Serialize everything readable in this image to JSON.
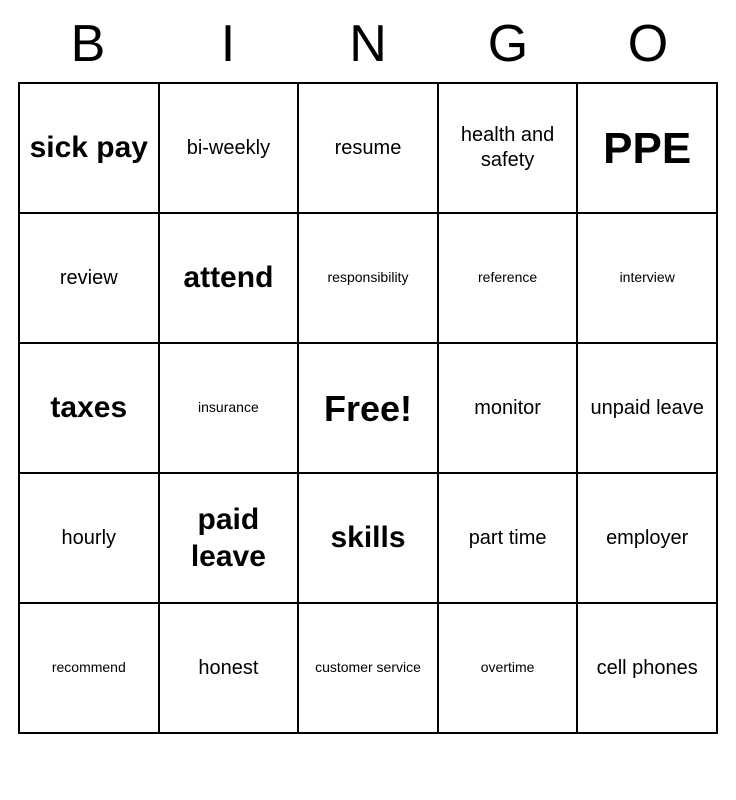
{
  "header": {
    "letters": [
      "B",
      "I",
      "N",
      "G",
      "O"
    ]
  },
  "cells": [
    {
      "text": "sick pay",
      "size": "large"
    },
    {
      "text": "bi-weekly",
      "size": "medium"
    },
    {
      "text": "resume",
      "size": "medium"
    },
    {
      "text": "health and safety",
      "size": "medium"
    },
    {
      "text": "PPE",
      "size": "xlarge"
    },
    {
      "text": "review",
      "size": "medium"
    },
    {
      "text": "attend",
      "size": "large"
    },
    {
      "text": "responsibility",
      "size": "small"
    },
    {
      "text": "reference",
      "size": "small"
    },
    {
      "text": "interview",
      "size": "small"
    },
    {
      "text": "taxes",
      "size": "large"
    },
    {
      "text": "insurance",
      "size": "small"
    },
    {
      "text": "Free!",
      "size": "free"
    },
    {
      "text": "monitor",
      "size": "medium"
    },
    {
      "text": "unpaid leave",
      "size": "medium"
    },
    {
      "text": "hourly",
      "size": "medium"
    },
    {
      "text": "paid leave",
      "size": "large"
    },
    {
      "text": "skills",
      "size": "large"
    },
    {
      "text": "part time",
      "size": "medium"
    },
    {
      "text": "employer",
      "size": "medium"
    },
    {
      "text": "recommend",
      "size": "small"
    },
    {
      "text": "honest",
      "size": "medium"
    },
    {
      "text": "customer service",
      "size": "small"
    },
    {
      "text": "overtime",
      "size": "small"
    },
    {
      "text": "cell phones",
      "size": "medium"
    }
  ]
}
